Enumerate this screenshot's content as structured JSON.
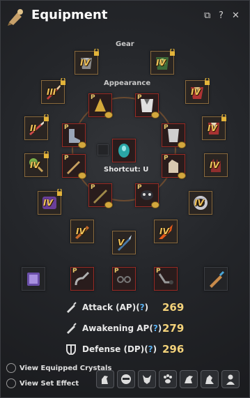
{
  "window": {
    "title": "Equipment",
    "controls": [
      "⧉",
      "?",
      "✕"
    ]
  },
  "sections": {
    "gear": "Gear",
    "appearance": "Appearance",
    "shortcut": "Shortcut: U"
  },
  "slot_markers": {
    "p": "P",
    "iv": "IV",
    "iii": "III",
    "ii": "II",
    "v": "V"
  },
  "stats": [
    {
      "label": "Attack (AP)",
      "help": "?",
      "value": "269"
    },
    {
      "label": "Awakening AP",
      "help": "?",
      "value": "279"
    },
    {
      "label": "Defense (DP)",
      "help": "?",
      "value": "296"
    }
  ],
  "links": {
    "crystals": "View Equipped Crystals",
    "set_effect": "View Set Effect"
  },
  "bottom_tabs": [
    "horse-icon",
    "mask-icon",
    "wolf-icon",
    "paw-icon",
    "dragon-icon",
    "mount-icon",
    "person-icon"
  ],
  "colors": {
    "tier": "#f1c35a",
    "stat_value": "#f3d27a",
    "help": "#5ab0f0",
    "slot_border": "#8a6a3d",
    "slot_red": "#9a2a24"
  }
}
